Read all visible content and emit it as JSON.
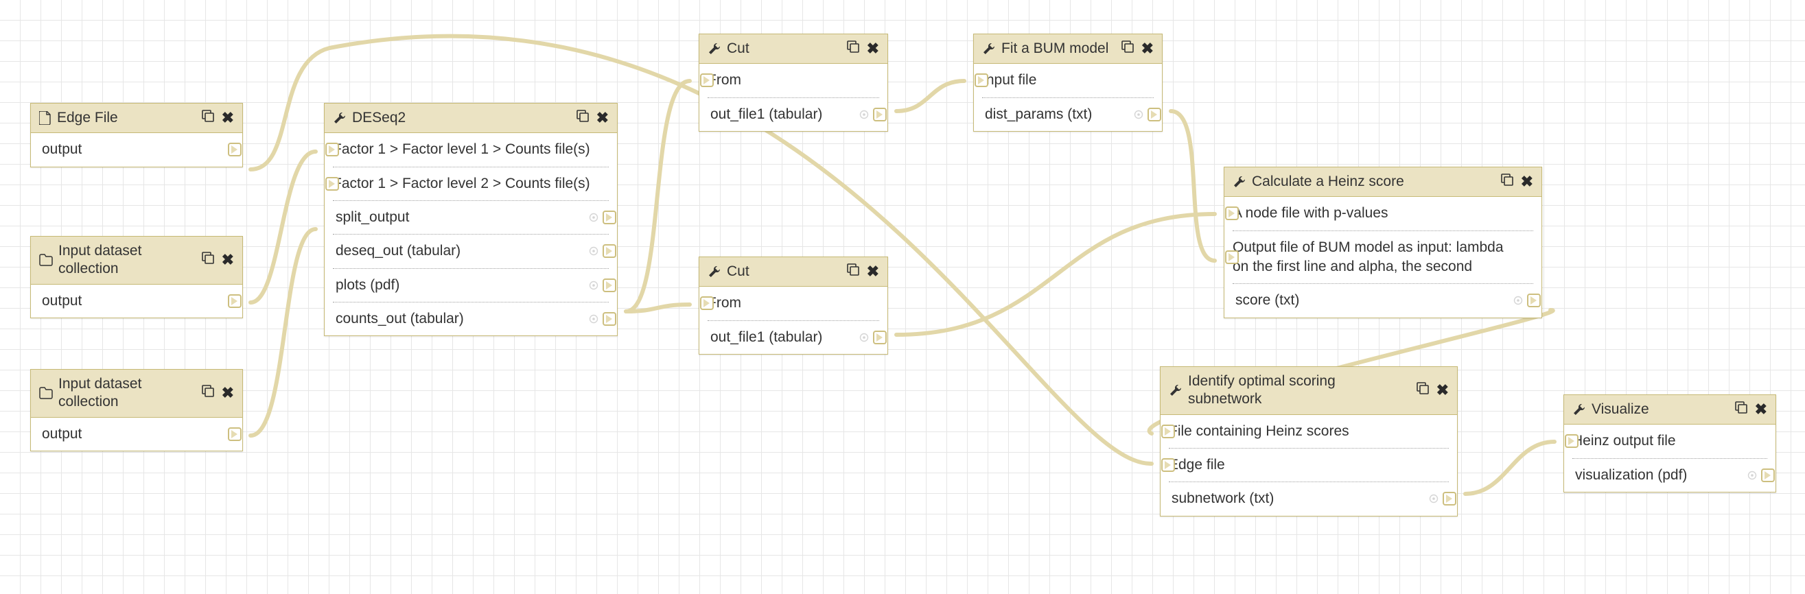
{
  "nodes": {
    "edge_file": {
      "title": "Edge File",
      "icon": "file",
      "outputs": [
        {
          "label": "output"
        }
      ]
    },
    "idc1": {
      "title": "Input dataset collection",
      "icon": "folder",
      "outputs": [
        {
          "label": "output"
        }
      ]
    },
    "idc2": {
      "title": "Input dataset collection",
      "icon": "folder",
      "outputs": [
        {
          "label": "output"
        }
      ]
    },
    "deseq2": {
      "title": "DESeq2",
      "icon": "wrench",
      "inputs": [
        {
          "label": "Factor 1 > Factor level 1 > Counts file(s)"
        },
        {
          "label": "Factor 1 > Factor level 2 > Counts file(s)"
        }
      ],
      "outputs": [
        {
          "label": "split_output"
        },
        {
          "label": "deseq_out (tabular)"
        },
        {
          "label": "plots (pdf)"
        },
        {
          "label": "counts_out (tabular)"
        }
      ]
    },
    "cut1": {
      "title": "Cut",
      "icon": "wrench",
      "inputs": [
        {
          "label": "From"
        }
      ],
      "outputs": [
        {
          "label": "out_file1 (tabular)"
        }
      ]
    },
    "cut2": {
      "title": "Cut",
      "icon": "wrench",
      "inputs": [
        {
          "label": "From"
        }
      ],
      "outputs": [
        {
          "label": "out_file1 (tabular)"
        }
      ]
    },
    "bum": {
      "title": "Fit a BUM model",
      "icon": "wrench",
      "inputs": [
        {
          "label": "Input file"
        }
      ],
      "outputs": [
        {
          "label": "dist_params (txt)"
        }
      ]
    },
    "heinz_score": {
      "title": "Calculate a Heinz score",
      "icon": "wrench",
      "inputs": [
        {
          "label": "A node file with p-values"
        },
        {
          "label": "Output file of BUM model as input: lambda on the first line and alpha, the second"
        }
      ],
      "outputs": [
        {
          "label": "score (txt)"
        }
      ]
    },
    "subnetwork": {
      "title": "Identify optimal scoring subnetwork",
      "icon": "wrench",
      "inputs": [
        {
          "label": "File containing Heinz scores"
        },
        {
          "label": "Edge file"
        }
      ],
      "outputs": [
        {
          "label": "subnetwork (txt)"
        }
      ]
    },
    "visualize": {
      "title": "Visualize",
      "icon": "wrench",
      "inputs": [
        {
          "label": "Heinz output file"
        }
      ],
      "outputs": [
        {
          "label": "visualization (pdf)"
        }
      ]
    }
  },
  "connections": [
    {
      "from": "edge_file.output",
      "to": "subnetwork.edge_file"
    },
    {
      "from": "idc1.output",
      "to": "deseq2.f1l1"
    },
    {
      "from": "idc2.output",
      "to": "deseq2.f1l2"
    },
    {
      "from": "deseq2.deseq_out",
      "to": "cut1.from"
    },
    {
      "from": "deseq2.deseq_out",
      "to": "cut2.from"
    },
    {
      "from": "cut1.out_file1",
      "to": "bum.input_file"
    },
    {
      "from": "bum.dist_params",
      "to": "heinz_score.bum_input"
    },
    {
      "from": "cut2.out_file1",
      "to": "heinz_score.node_pvalues"
    },
    {
      "from": "heinz_score.score",
      "to": "subnetwork.heinz_scores"
    },
    {
      "from": "subnetwork.subnetwork",
      "to": "visualize.heinz_output"
    }
  ]
}
